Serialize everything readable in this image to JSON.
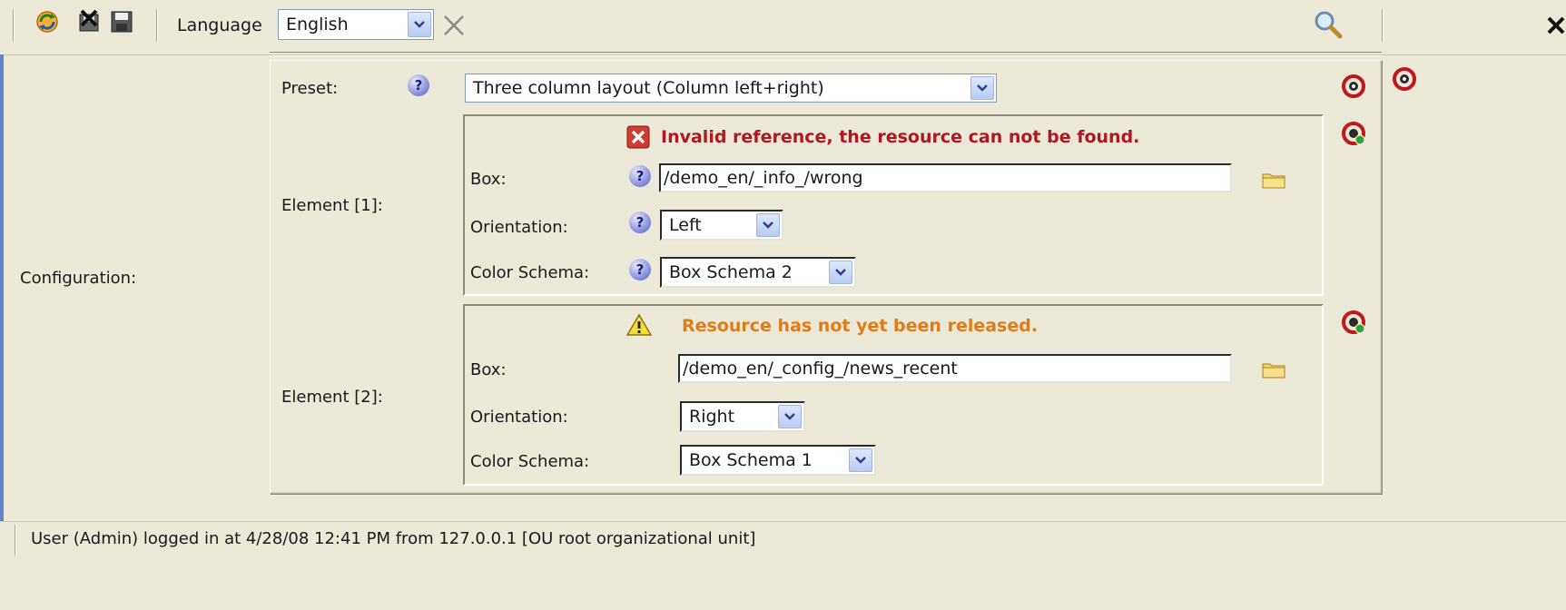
{
  "toolbar": {
    "language_label": "Language",
    "language_value": "English"
  },
  "form": {
    "configuration_label": "Configuration:",
    "preset_label": "Preset:",
    "preset_value": "Three column layout (Column left+right)",
    "elements": [
      {
        "label": "Element [1]:",
        "message": "Invalid reference, the resource can not be found.",
        "message_type": "error",
        "box_label": "Box:",
        "box_value": "/demo_en/_info_/wrong",
        "orientation_label": "Orientation:",
        "orientation_value": "Left",
        "color_label": "Color Schema:",
        "color_value": "Box Schema 2"
      },
      {
        "label": "Element [2]:",
        "message": "Resource has not yet been released.",
        "message_type": "warning",
        "box_label": "Box:",
        "box_value": "/demo_en/_config_/news_recent",
        "orientation_label": "Orientation:",
        "orientation_value": "Right",
        "color_label": "Color Schema:",
        "color_value": "Box Schema 1"
      }
    ]
  },
  "status": {
    "text": "User (Admin) logged in at 4/28/08 12:41 PM from 127.0.0.1 [OU root organizational unit]"
  },
  "colors": {
    "background": "#ECE9D8",
    "error": "#b0181e",
    "warning": "#e07b16"
  }
}
